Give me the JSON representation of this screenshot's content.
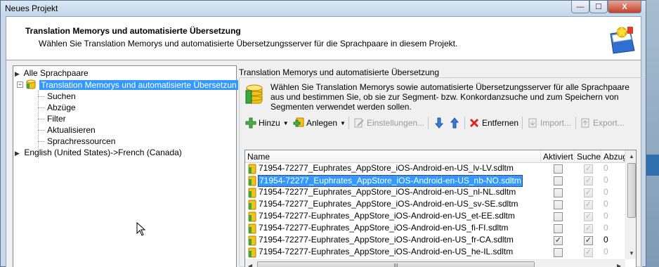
{
  "window": {
    "title": "Neues Projekt"
  },
  "header": {
    "title": "Translation Memorys und automatisierte Übersetzung",
    "subtitle": "Wählen Sie Translation Memorys und automatisierte Übersetzungsserver für die Sprachpaare in diesem Projekt."
  },
  "tree": {
    "items": [
      {
        "label": "Alle Sprachpaare"
      },
      {
        "label": "Translation Memorys und automatisierte Übersetzun"
      },
      {
        "label": "Suchen"
      },
      {
        "label": "Abzüge"
      },
      {
        "label": "Filter"
      },
      {
        "label": "Aktualisieren"
      },
      {
        "label": "Sprachressourcen"
      },
      {
        "label": "English (United States)->French (Canada)"
      }
    ]
  },
  "panel": {
    "group_caption": "Translation Memorys und automatisierte Übersetzung",
    "description": "Wählen Sie Translation Memorys sowie automatisierte Übersetzungsserver für alle Sprachpaare aus und bestimmen Sie, ob sie zur Segment- bzw. Konkordanzsuche und zum Speichern von Segmenten verwendet werden sollen."
  },
  "toolbar": {
    "add": "Hinzu",
    "create": "Anlegen",
    "settings": "Einstellungen...",
    "remove": "Entfernen",
    "import": "Import...",
    "export": "Export..."
  },
  "list": {
    "columns": {
      "name": "Name",
      "enabled": "Aktiviert",
      "search": "Suche",
      "penalty": "Abzug"
    },
    "rows": [
      {
        "name": "71954-72277_Euphrates_AppStore_iOS-Android-en-US_lv-LV.sdltm",
        "enabled": false,
        "search": true,
        "penalty": "0"
      },
      {
        "name": "71954-72277_Euphrates_AppStore_iOS-Android-en-US_nb-NO.sdltm",
        "enabled": false,
        "search": true,
        "penalty": "0"
      },
      {
        "name": "71954-72277_Euphrates_AppStore_iOS-Android-en-US_nl-NL.sdltm",
        "enabled": false,
        "search": true,
        "penalty": "0"
      },
      {
        "name": "71954-72277_Euphrates_AppStore_iOS-Android-en-US_sv-SE.sdltm",
        "enabled": false,
        "search": true,
        "penalty": "0"
      },
      {
        "name": "71954-72277-Euphrates_AppStore_iOS-Android-en-US_et-EE.sdltm",
        "enabled": false,
        "search": true,
        "penalty": "0"
      },
      {
        "name": "71954-72277-Euphrates_AppStore_iOS-Android-en-US_fi-FI.sdltm",
        "enabled": false,
        "search": true,
        "penalty": "0"
      },
      {
        "name": "71954-72277-Euphrates_AppStore_iOS-Android-en-US_fr-CA.sdltm",
        "enabled": true,
        "search": true,
        "penalty": "0"
      },
      {
        "name": "71954-72277-Euphrates_AppStore_iOS-Android-en-US_he-IL.sdltm",
        "enabled": false,
        "search": true,
        "penalty": "0"
      }
    ]
  },
  "glyphs": {
    "check": "✓",
    "minimize": "—",
    "maximize": "☐",
    "close": "X",
    "dropdown": "▼",
    "scroll_grip": "|||"
  },
  "colors": {
    "selection": "#3399ff",
    "window_frame": "#c9d9ea",
    "remove_icon": "#d9261c"
  }
}
